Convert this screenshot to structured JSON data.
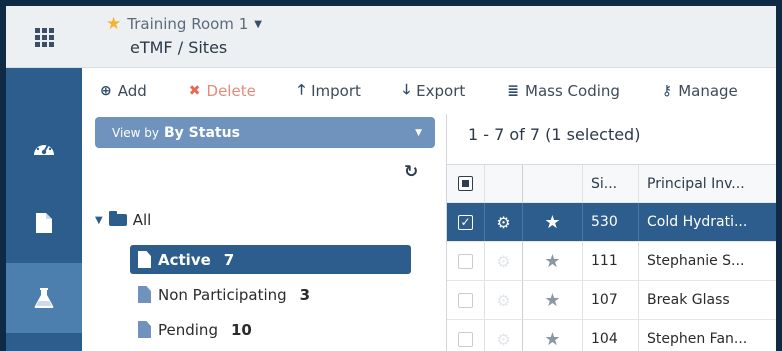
{
  "header": {
    "room_name": "Training Room 1",
    "breadcrumb": "eTMF / Sites"
  },
  "nav": {
    "items": [
      {
        "icon": "dashboard-icon",
        "active": false
      },
      {
        "icon": "document-icon",
        "active": false
      },
      {
        "icon": "flask-icon",
        "active": true
      }
    ]
  },
  "toolbar": {
    "add_label": "Add",
    "delete_label": "Delete",
    "import_label": "Import",
    "export_label": "Export",
    "mass_coding_label": "Mass Coding",
    "manage_label": "Manage"
  },
  "left_panel": {
    "view_by_prefix": "View by",
    "view_by_value": "By Status"
  },
  "tree": {
    "root_label": "All",
    "nodes": [
      {
        "label": "Active",
        "count": "7",
        "selected": true
      },
      {
        "label": "Non Participating",
        "count": "3",
        "selected": false
      },
      {
        "label": "Pending",
        "count": "10",
        "selected": false
      }
    ]
  },
  "grid": {
    "pager_text": "1 - 7 of 7 (1 selected)",
    "columns": [
      "Si...",
      "Principal Inv..."
    ],
    "rows": [
      {
        "site": "530",
        "pi": "Cold Hydrati...",
        "selected": true
      },
      {
        "site": "111",
        "pi": "Stephanie S...",
        "selected": false
      },
      {
        "site": "107",
        "pi": "Break Glass",
        "selected": false
      },
      {
        "site": "104",
        "pi": "Stephen Fan...",
        "selected": false
      }
    ]
  },
  "colors": {
    "nav_bg": "#2c5d8c",
    "nav_active": "#4d7fae",
    "selection": "#2d5d8c",
    "view_by_bg": "#6f93bd",
    "star_gold": "#f2b232",
    "delete_red": "#e86a55"
  }
}
